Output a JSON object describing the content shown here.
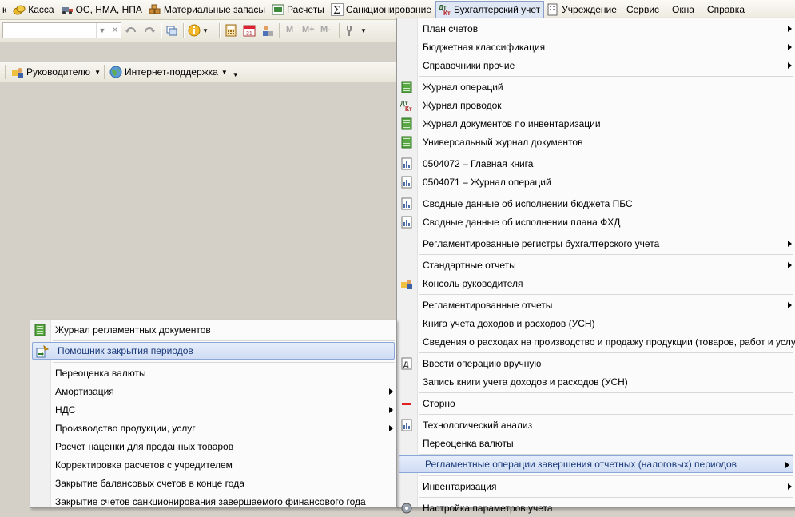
{
  "menubar": {
    "items": [
      {
        "label": "к",
        "icon": ""
      },
      {
        "label": "Касса",
        "icon": "cash-icon"
      },
      {
        "label": "ОС, НМА, НПА",
        "icon": "truck-icon"
      },
      {
        "label": "Материальные запасы",
        "icon": "boxes-icon"
      },
      {
        "label": "Расчеты",
        "icon": "calc-icon"
      },
      {
        "label": "Санкционирование",
        "icon": "sigma-icon"
      },
      {
        "label": "Бухгалтерский учет",
        "icon": "dt-kt-icon"
      },
      {
        "label": "Учреждение",
        "icon": "building-icon"
      },
      {
        "label": "Сервис",
        "icon": ""
      },
      {
        "label": "Окна",
        "icon": ""
      },
      {
        "label": "Справка",
        "icon": ""
      }
    ]
  },
  "toolbar": {
    "search_value": "",
    "m_label": "M",
    "mplus_label": "M+",
    "mminus_label": "M-"
  },
  "toolbar2": {
    "manager_label": "Руководителю",
    "internet_label": "Интернет-поддержка"
  },
  "main_menu": {
    "items": [
      {
        "label": "План счетов",
        "icon": "",
        "submenu": true
      },
      {
        "label": "Бюджетная классификация",
        "icon": "",
        "submenu": true
      },
      {
        "label": "Справочники прочие",
        "icon": "",
        "submenu": true,
        "sep_after": true
      },
      {
        "label": "Журнал операций",
        "icon": "journal-green-icon"
      },
      {
        "label": "Журнал проводок",
        "icon": "dt-kt-icon"
      },
      {
        "label": "Журнал документов по инвентаризации",
        "icon": "journal-green-icon"
      },
      {
        "label": "Универсальный журнал документов",
        "icon": "journal-green-icon",
        "sep_after": true
      },
      {
        "label": "0504072  –  Главная книга",
        "icon": "report-icon"
      },
      {
        "label": "0504071  –  Журнал операций",
        "icon": "report-icon",
        "sep_after": true
      },
      {
        "label": "Сводные данные об исполнении бюджета ПБС",
        "icon": "report-icon"
      },
      {
        "label": "Сводные данные об исполнении плана ФХД",
        "icon": "report-icon",
        "sep_after": true
      },
      {
        "label": "Регламентированные регистры бухгалтерского учета",
        "icon": "",
        "submenu": true,
        "sep_after": true
      },
      {
        "label": "Стандартные отчеты",
        "icon": "",
        "submenu": true
      },
      {
        "label": "Консоль руководителя",
        "icon": "manager-console-icon",
        "sep_after": true
      },
      {
        "label": "Регламентированные отчеты",
        "icon": "",
        "submenu": true
      },
      {
        "label": "Книга учета доходов и расходов (УСН)",
        "icon": ""
      },
      {
        "label": "Сведения о расходах на производство и продажу продукции (товаров, работ и услуг)",
        "icon": "",
        "sep_after": true
      },
      {
        "label": "Ввести операцию вручную",
        "icon": "manual-operation-icon"
      },
      {
        "label": "Запись книги учета доходов и расходов (УСН)",
        "icon": "",
        "sep_after": true
      },
      {
        "label": "Сторно",
        "icon": "storno-icon",
        "sep_after": true
      },
      {
        "label": "Технологический анализ",
        "icon": "report-icon"
      },
      {
        "label": "Переоценка валюты",
        "icon": "",
        "sep_after": true
      },
      {
        "label": "Регламентные операции завершения отчетных (налоговых) периодов",
        "icon": "",
        "submenu": true,
        "highlighted": true,
        "sep_after": true
      },
      {
        "label": "Инвентаризация",
        "icon": "",
        "submenu": true,
        "sep_after": true
      },
      {
        "label": "Настройка параметров учета",
        "icon": "settings-icon"
      }
    ]
  },
  "sub_menu": {
    "items": [
      {
        "label": "Журнал регламентных документов",
        "icon": "journal-green-icon",
        "sep_after": true
      },
      {
        "label": "Помощник закрытия периодов",
        "icon": "wizard-icon",
        "highlighted": true,
        "sep_after": true
      },
      {
        "label": "Переоценка валюты",
        "icon": ""
      },
      {
        "label": "Амортизация",
        "icon": "",
        "submenu": true
      },
      {
        "label": "НДС",
        "icon": "",
        "submenu": true
      },
      {
        "label": "Производство продукции, услуг",
        "icon": "",
        "submenu": true
      },
      {
        "label": "Расчет наценки для проданных товаров",
        "icon": ""
      },
      {
        "label": "Корректировка расчетов с учредителем",
        "icon": ""
      },
      {
        "label": "Закрытие балансовых счетов в конце года",
        "icon": ""
      },
      {
        "label": "Закрытие счетов санкционирования завершаемого финансового года",
        "icon": ""
      }
    ]
  }
}
